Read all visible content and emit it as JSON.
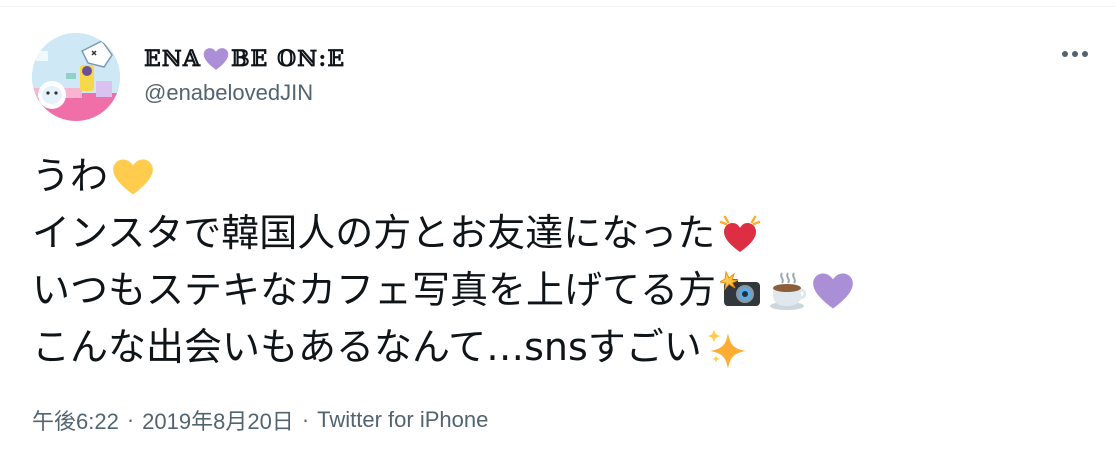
{
  "tweet": {
    "display_name_left": "𝔼ℕ𝔸",
    "display_name_right": "𝔹𝔼 𝕆ℕ:𝔼",
    "handle": "@enabelovedJIN",
    "lines": [
      "うわ",
      "インスタで韓国人の方とお友達になった",
      "いつもステキなカフェ写真を上げてる方",
      "こんな出会いもあるなんて…snsすごい"
    ],
    "time": "午後6:22",
    "date": "2019年8月20日",
    "separator": "·",
    "source": "Twitter for iPhone"
  },
  "icons": {
    "name_emoji": "purple-heart-icon",
    "line1_emoji": "yellow-heart-icon",
    "line2_emoji": "beating-heart-icon",
    "line3_emojis": [
      "camera-with-flash-icon",
      "hot-coffee-icon",
      "purple-heart-icon"
    ],
    "line4_emoji": "sparkles-icon",
    "more": "more-options-icon"
  },
  "colors": {
    "text": "#0f1419",
    "secondary": "#536471",
    "yellow_heart": "#ffcc4d",
    "purple_heart": "#aa8ed6",
    "red_heart": "#dd2e44"
  }
}
